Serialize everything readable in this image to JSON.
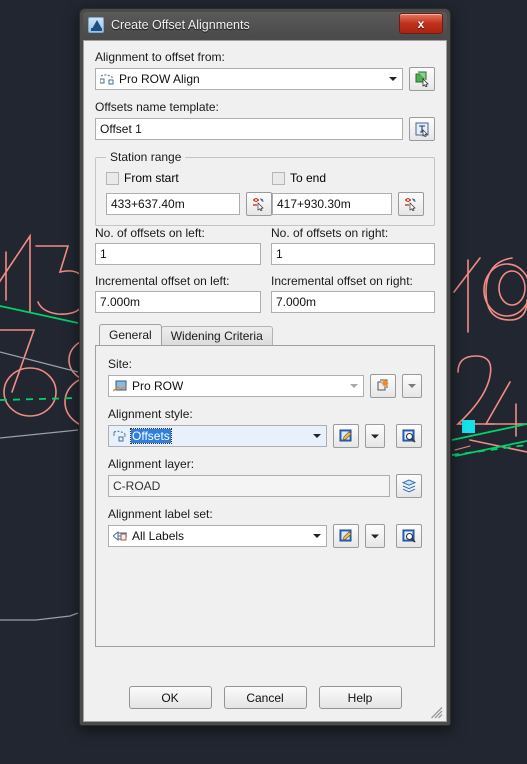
{
  "window": {
    "title": "Create Offset Alignments",
    "app_icon": "autocad-icon",
    "close_label": "x"
  },
  "form": {
    "alignment_source": {
      "label": "Alignment to offset from:",
      "value": "Pro ROW Align",
      "icon": "alignment-icon",
      "pick_button_icon": "pick-object-icon"
    },
    "name_template": {
      "label": "Offsets name template:",
      "value": "Offset 1",
      "edit_button_icon": "name-template-icon"
    },
    "station_range": {
      "legend": "Station range",
      "from_start": {
        "label": "From start",
        "checked": false
      },
      "to_end": {
        "label": "To end",
        "checked": false
      },
      "start_station": "433+637.40m",
      "end_station": "417+930.30m",
      "pick_icon": "station-pick-icon"
    },
    "offsets_left_count": {
      "label": "No. of offsets on left:",
      "value": "1"
    },
    "offsets_right_count": {
      "label": "No. of offsets on right:",
      "value": "1"
    },
    "increment_left": {
      "label": "Incremental offset on left:",
      "value": "7.000m"
    },
    "increment_right": {
      "label": "Incremental offset on right:",
      "value": "7.000m"
    }
  },
  "tabs": [
    {
      "label": "General",
      "active": true
    },
    {
      "label": "Widening Criteria",
      "active": false
    }
  ],
  "general_tab": {
    "site": {
      "label": "Site:",
      "value": "Pro ROW",
      "icon": "site-icon",
      "new_button_icon": "new-site-icon",
      "dropdown_icon": "chevron-down-icon"
    },
    "alignment_style": {
      "label": "Alignment style:",
      "value": "Offsets",
      "selected": true,
      "icon": "alignment-style-icon",
      "edit_button_icon": "edit-style-icon",
      "dropdown_icon": "chevron-down-icon",
      "preview_button_icon": "preview-icon"
    },
    "alignment_layer": {
      "label": "Alignment layer:",
      "value": "C-ROAD",
      "button_icon": "layers-icon"
    },
    "alignment_label_set": {
      "label": "Alignment label set:",
      "value": "All Labels",
      "icon": "label-set-icon",
      "edit_button_icon": "edit-style-icon",
      "dropdown_icon": "chevron-down-icon",
      "preview_button_icon": "preview-icon"
    }
  },
  "footer": {
    "ok": "OK",
    "cancel": "Cancel",
    "help": "Help"
  },
  "colors": {
    "cad_background": "#212630",
    "cad_geometry": "#f08c84",
    "cad_green": "#00d26a",
    "cad_grey": "#9aa0a6",
    "cad_grip": "#16e0e8",
    "selection_blue": "#2f7fe0",
    "close_red": "#c2321c"
  }
}
